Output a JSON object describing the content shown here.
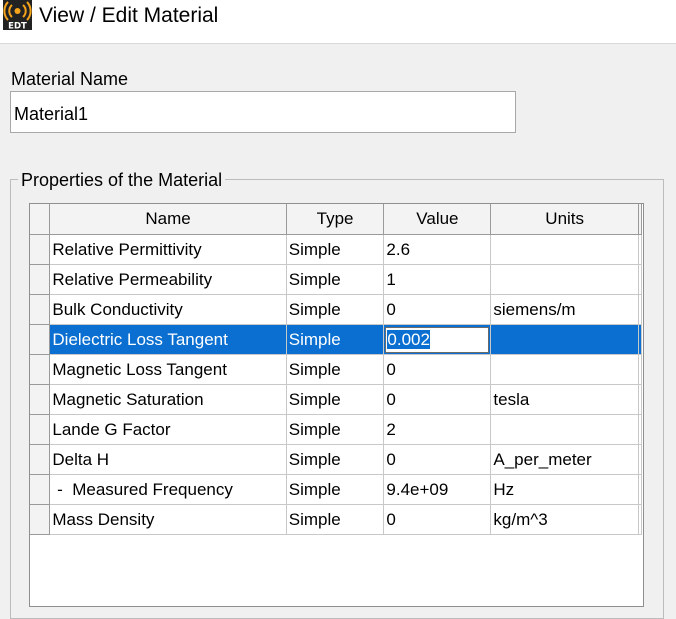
{
  "window": {
    "title": "View / Edit Material",
    "icon": "edt-app-icon",
    "icon_text": "EDT"
  },
  "material_name": {
    "label": "Material Name",
    "value": "Material1"
  },
  "properties": {
    "group_label": "Properties of the Material",
    "columns": [
      "Name",
      "Type",
      "Value",
      "Units"
    ],
    "selected_row": 3,
    "rows": [
      {
        "name": "Relative Permittivity",
        "type": "Simple",
        "value": "2.6",
        "units": ""
      },
      {
        "name": "Relative Permeability",
        "type": "Simple",
        "value": "1",
        "units": ""
      },
      {
        "name": "Bulk Conductivity",
        "type": "Simple",
        "value": "0",
        "units": "siemens/m"
      },
      {
        "name": "Dielectric Loss Tangent",
        "type": "Simple",
        "value": "0.002",
        "units": ""
      },
      {
        "name": "Magnetic Loss Tangent",
        "type": "Simple",
        "value": "0",
        "units": ""
      },
      {
        "name": "Magnetic Saturation",
        "type": "Simple",
        "value": "0",
        "units": "tesla"
      },
      {
        "name": "Lande G Factor",
        "type": "Simple",
        "value": "2",
        "units": ""
      },
      {
        "name": "Delta H",
        "type": "Simple",
        "value": "0",
        "units": "A_per_meter"
      },
      {
        "name": " -  Measured Frequency",
        "type": "Simple",
        "value": "9.4e+09",
        "units": "Hz"
      },
      {
        "name": "Mass Density",
        "type": "Simple",
        "value": "0",
        "units": "kg/m^3"
      }
    ]
  },
  "colors": {
    "selection": "#0a6fd0",
    "background": "#f0f0f0",
    "icon_orange": "#f5a31a"
  }
}
